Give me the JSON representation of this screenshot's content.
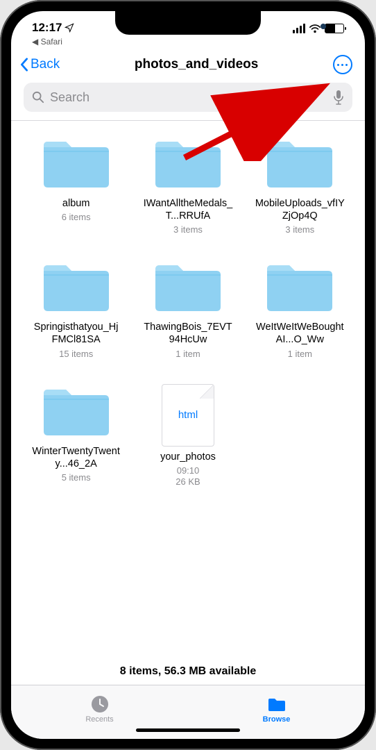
{
  "status": {
    "time": "12:17",
    "back_to_app": "Safari"
  },
  "nav": {
    "back_label": "Back",
    "title": "photos_and_videos"
  },
  "search": {
    "placeholder": "Search"
  },
  "items": [
    {
      "type": "folder",
      "name": "album",
      "meta": "6 items"
    },
    {
      "type": "folder",
      "name": "IWantAlltheMedals_T...RRUfA",
      "meta": "3 items"
    },
    {
      "type": "folder",
      "name": "MobileUploads_vfIYZjOp4Q",
      "meta": "3 items"
    },
    {
      "type": "folder",
      "name": "Springisthatyou_HjFMCl81SA",
      "meta": "15 items"
    },
    {
      "type": "folder",
      "name": "ThawingBois_7EVT94HcUw",
      "meta": "1 item"
    },
    {
      "type": "folder",
      "name": "WeItWeItWeBoughtAI...O_Ww",
      "meta": "1 item"
    },
    {
      "type": "folder",
      "name": "WinterTwentyTwenty...46_2A",
      "meta": "5 items"
    },
    {
      "type": "file",
      "name": "your_photos",
      "meta": "09:10",
      "meta2": "26 KB",
      "ext": "html"
    }
  ],
  "footer_status": "8 items, 56.3 MB available",
  "tabs": {
    "recents": "Recents",
    "browse": "Browse"
  }
}
